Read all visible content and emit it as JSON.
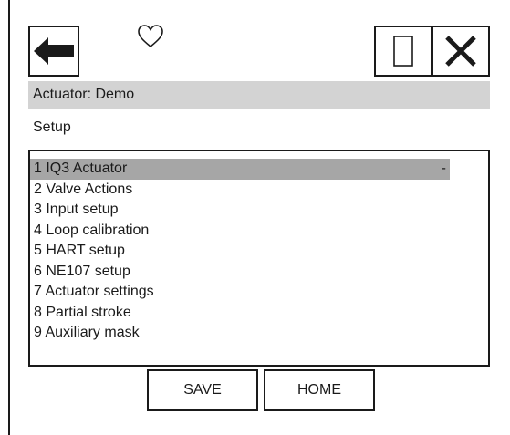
{
  "header": {
    "back_icon": "back-arrow-icon",
    "favorite_icon": "heart-icon",
    "window_icon": "square-icon",
    "close_icon": "close-icon"
  },
  "title": "Actuator: Demo",
  "subtitle": "Setup",
  "menu": {
    "items": [
      {
        "label": "1 IQ3 Actuator",
        "value": "-",
        "selected": true
      },
      {
        "label": "2 Valve Actions",
        "value": ""
      },
      {
        "label": "3 Input setup",
        "value": ""
      },
      {
        "label": "4 Loop calibration",
        "value": ""
      },
      {
        "label": "5 HART setup",
        "value": ""
      },
      {
        "label": "6 NE107 setup",
        "value": ""
      },
      {
        "label": "7 Actuator settings",
        "value": ""
      },
      {
        "label": "8 Partial stroke",
        "value": ""
      },
      {
        "label": "9 Auxiliary mask",
        "value": ""
      }
    ]
  },
  "footer": {
    "save_label": "SAVE",
    "home_label": "HOME"
  },
  "colors": {
    "title_bar": "#d3d3d3",
    "selected_row": "#a6a6a6",
    "border": "#1a1a1a"
  }
}
